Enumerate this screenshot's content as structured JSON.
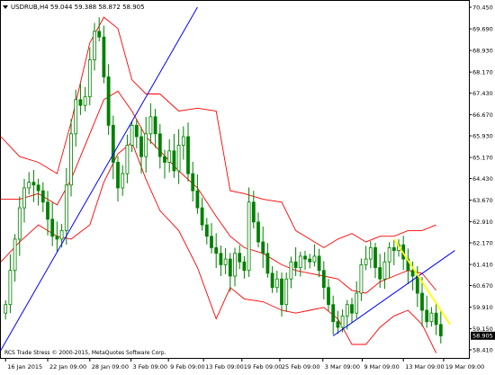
{
  "window": {
    "symbol_line": "USDRUB,H4  59.044 59.388 58.872 58.905",
    "copyright": "RCS Trade Stress © 2000-2015, MetaQuotes Software Corp."
  },
  "colors": {
    "background": "#ffffff",
    "candle": "#008000",
    "bands": "#ff0000",
    "trendline_blue": "#0000ff",
    "trendline_yellow": "#ffff00",
    "axis": "#000000",
    "price_tag_bg": "#000000"
  },
  "chart_data": {
    "type": "candlestick",
    "title": "USDRUB,H4",
    "ohlc_readout": {
      "open": 59.044,
      "high": 59.388,
      "low": 58.872,
      "close": 58.905
    },
    "current_price": "58.905",
    "y_ticks": [
      "70.450",
      "69.690",
      "68.930",
      "68.170",
      "67.430",
      "66.670",
      "65.930",
      "65.170",
      "64.430",
      "63.670",
      "62.910",
      "62.170",
      "61.410",
      "60.670",
      "59.910",
      "59.150",
      "58.410"
    ],
    "x_ticks": [
      "16 Jan 2015",
      "22 Jan 09:00",
      "28 Jan 09:00",
      "3 Feb 09:00",
      "9 Feb 09:00",
      "13 Feb 09:00",
      "19 Feb 09:00",
      "25 Feb 09:00",
      "3 Mar 09:00",
      "9 Mar 09:00",
      "13 Mar 09:00",
      "19 Mar 09:00"
    ],
    "ylim": [
      58.41,
      70.45
    ],
    "xlim": [
      0,
      100
    ],
    "candles_close_path": [
      [
        1,
        60.0
      ],
      [
        2,
        61.2
      ],
      [
        3,
        62.3
      ],
      [
        4,
        63.4
      ],
      [
        5,
        64.1
      ],
      [
        6,
        64.3
      ],
      [
        7,
        64.2
      ],
      [
        8,
        64.0
      ],
      [
        9,
        63.6
      ],
      [
        10,
        63.0
      ],
      [
        11,
        62.4
      ],
      [
        12,
        62.3
      ],
      [
        13,
        62.6
      ],
      [
        14,
        64.2
      ],
      [
        15,
        66.0
      ],
      [
        16,
        67.2
      ],
      [
        17,
        67.0
      ],
      [
        18,
        67.3
      ],
      [
        19,
        68.6
      ],
      [
        20,
        69.6
      ],
      [
        21,
        69.4
      ],
      [
        22,
        68.0
      ],
      [
        23,
        66.3
      ],
      [
        24,
        65.0
      ],
      [
        25,
        64.1
      ],
      [
        26,
        64.6
      ],
      [
        27,
        65.6
      ],
      [
        28,
        66.3
      ],
      [
        29,
        65.9
      ],
      [
        30,
        65.2
      ],
      [
        31,
        66.0
      ],
      [
        32,
        66.6
      ],
      [
        33,
        66.0
      ],
      [
        34,
        65.2
      ],
      [
        35,
        65.0
      ],
      [
        36,
        65.4
      ],
      [
        37,
        64.7
      ],
      [
        38,
        65.6
      ],
      [
        39,
        65.9
      ],
      [
        40,
        64.6
      ],
      [
        41,
        64.0
      ],
      [
        42,
        63.4
      ],
      [
        43,
        62.8
      ],
      [
        44,
        62.4
      ],
      [
        45,
        62.0
      ],
      [
        46,
        61.8
      ],
      [
        47,
        61.4
      ],
      [
        48,
        61.6
      ],
      [
        49,
        61.0
      ],
      [
        50,
        61.8
      ],
      [
        51,
        61.5
      ],
      [
        52,
        61.2
      ],
      [
        53,
        63.6
      ],
      [
        54,
        62.9
      ],
      [
        55,
        62.2
      ],
      [
        56,
        61.8
      ],
      [
        57,
        61.1
      ],
      [
        58,
        60.6
      ],
      [
        59,
        60.9
      ],
      [
        60,
        60.0
      ],
      [
        61,
        60.9
      ],
      [
        62,
        61.5
      ],
      [
        63,
        61.3
      ],
      [
        64,
        61.7
      ],
      [
        65,
        61.6
      ],
      [
        66,
        61.5
      ],
      [
        67,
        61.7
      ],
      [
        68,
        61.2
      ],
      [
        69,
        60.6
      ],
      [
        70,
        60.0
      ],
      [
        71,
        59.4
      ],
      [
        72,
        59.2
      ],
      [
        73,
        59.6
      ],
      [
        74,
        60.0
      ],
      [
        75,
        59.7
      ],
      [
        76,
        60.4
      ],
      [
        77,
        61.4
      ],
      [
        78,
        61.6
      ],
      [
        79,
        62.0
      ],
      [
        80,
        61.3
      ],
      [
        81,
        60.9
      ],
      [
        82,
        61.5
      ],
      [
        83,
        62.0
      ],
      [
        84,
        61.9
      ],
      [
        85,
        62.1
      ],
      [
        86,
        61.6
      ],
      [
        87,
        61.2
      ],
      [
        88,
        61.0
      ],
      [
        89,
        60.4
      ],
      [
        90,
        59.8
      ],
      [
        91,
        59.4
      ],
      [
        92,
        59.7
      ],
      [
        93,
        59.3
      ],
      [
        94,
        58.9
      ]
    ],
    "bollinger_upper": [
      [
        0,
        65.9
      ],
      [
        4,
        65.2
      ],
      [
        8,
        65.0
      ],
      [
        12,
        64.6
      ],
      [
        15,
        66.4
      ],
      [
        19,
        69.2
      ],
      [
        22,
        70.1
      ],
      [
        25,
        69.7
      ],
      [
        28,
        67.9
      ],
      [
        31,
        67.4
      ],
      [
        34,
        67.4
      ],
      [
        38,
        66.8
      ],
      [
        42,
        66.9
      ],
      [
        46,
        66.8
      ],
      [
        49,
        64.0
      ],
      [
        52,
        63.9
      ],
      [
        56,
        63.7
      ],
      [
        60,
        63.6
      ],
      [
        63,
        62.6
      ],
      [
        66,
        62.3
      ],
      [
        69,
        62.0
      ],
      [
        72,
        62.3
      ],
      [
        75,
        62.5
      ],
      [
        78,
        62.2
      ],
      [
        81,
        62.4
      ],
      [
        84,
        62.4
      ],
      [
        87,
        62.6
      ],
      [
        90,
        62.6
      ],
      [
        93,
        62.8
      ]
    ],
    "bollinger_middle": [
      [
        0,
        63.7
      ],
      [
        4,
        63.7
      ],
      [
        8,
        63.9
      ],
      [
        12,
        63.5
      ],
      [
        15,
        64.4
      ],
      [
        19,
        66.0
      ],
      [
        22,
        67.2
      ],
      [
        25,
        67.5
      ],
      [
        28,
        66.8
      ],
      [
        31,
        65.9
      ],
      [
        34,
        65.4
      ],
      [
        38,
        64.7
      ],
      [
        42,
        64.1
      ],
      [
        46,
        63.1
      ],
      [
        49,
        62.4
      ],
      [
        52,
        62.0
      ],
      [
        56,
        61.8
      ],
      [
        60,
        61.4
      ],
      [
        63,
        61.2
      ],
      [
        66,
        61.1
      ],
      [
        69,
        61.0
      ],
      [
        72,
        60.9
      ],
      [
        75,
        60.5
      ],
      [
        78,
        60.4
      ],
      [
        81,
        60.8
      ],
      [
        84,
        61.0
      ],
      [
        87,
        61.2
      ],
      [
        90,
        61.1
      ],
      [
        93,
        60.5
      ]
    ],
    "bollinger_lower": [
      [
        0,
        61.5
      ],
      [
        4,
        62.2
      ],
      [
        8,
        62.8
      ],
      [
        12,
        62.4
      ],
      [
        15,
        62.3
      ],
      [
        19,
        62.8
      ],
      [
        22,
        64.3
      ],
      [
        25,
        65.3
      ],
      [
        28,
        65.7
      ],
      [
        31,
        64.4
      ],
      [
        34,
        63.3
      ],
      [
        38,
        62.6
      ],
      [
        42,
        61.3
      ],
      [
        46,
        59.5
      ],
      [
        49,
        60.6
      ],
      [
        52,
        60.2
      ],
      [
        56,
        60.1
      ],
      [
        60,
        59.8
      ],
      [
        63,
        59.7
      ],
      [
        66,
        59.8
      ],
      [
        69,
        59.9
      ],
      [
        72,
        59.5
      ],
      [
        75,
        58.6
      ],
      [
        78,
        58.6
      ],
      [
        81,
        59.2
      ],
      [
        84,
        59.6
      ],
      [
        87,
        59.8
      ],
      [
        90,
        59.3
      ],
      [
        93,
        58.3
      ]
    ],
    "trendlines": [
      {
        "color": "blue",
        "from": [
          0,
          58.4
        ],
        "to": [
          42,
          70.45
        ]
      },
      {
        "color": "blue",
        "from": [
          71,
          58.9
        ],
        "to": [
          97,
          61.9
        ]
      },
      {
        "color": "yellow",
        "from": [
          84,
          62.3
        ],
        "to": [
          96,
          59.3
        ]
      }
    ],
    "grid": false,
    "legend": "none"
  }
}
